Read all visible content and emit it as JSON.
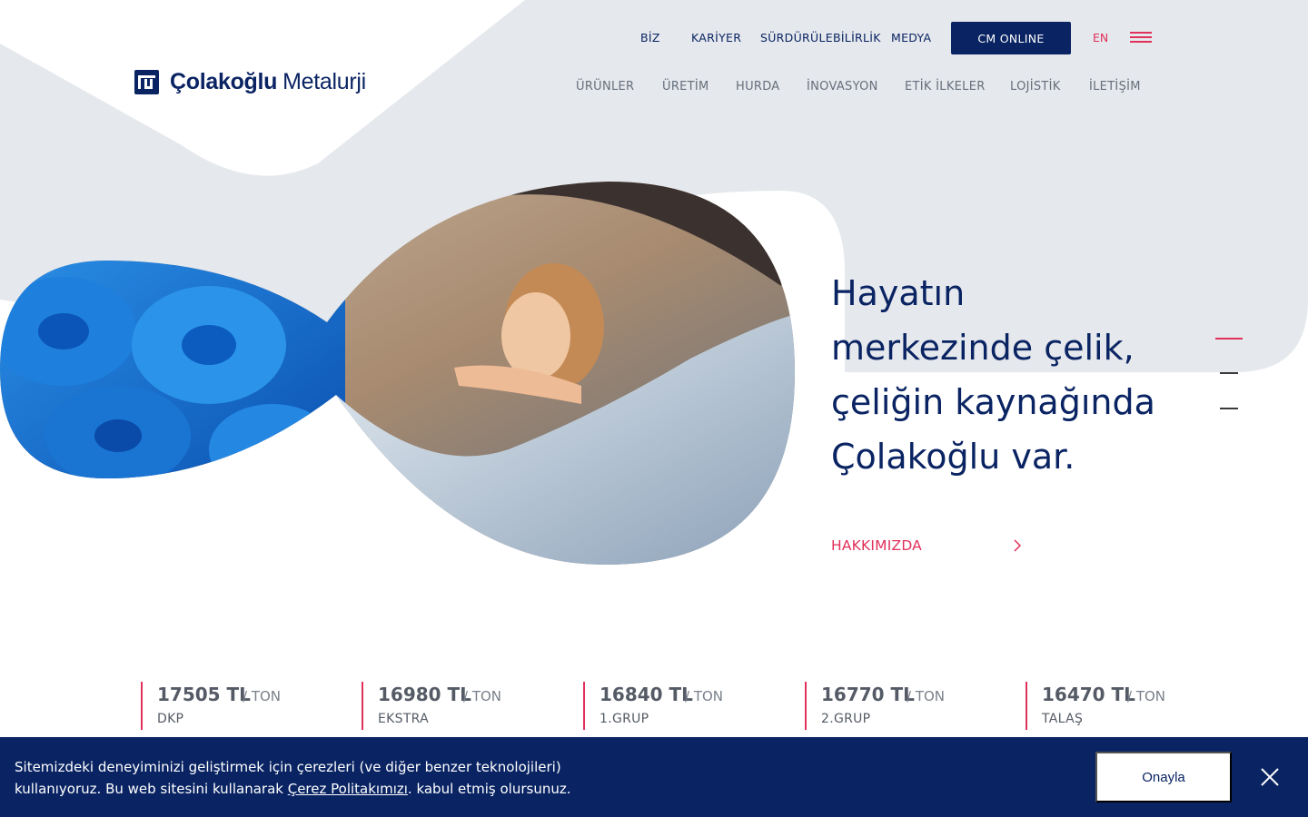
{
  "brand": {
    "name_bold": "Çolakoğlu",
    "name_light": "Metalurji",
    "primary_color": "#0a2463",
    "accent_color": "#e0315b",
    "background_shape_color": "#e5e8ec"
  },
  "top_nav": {
    "items": [
      "BİZ",
      "KARİYER",
      "SÜRDÜRÜLEBİLİRLİK",
      "MEDYA"
    ],
    "cm_online": "CM ONLINE",
    "language": "EN",
    "menu_icon": "hamburger-icon"
  },
  "main_nav": {
    "items": [
      "ÜRÜNLER",
      "ÜRETİM",
      "HURDA",
      "İNOVASYON",
      "ETİK İLKELER",
      "LOJİSTİK",
      "İLETİŞİM"
    ]
  },
  "hero": {
    "title_lines": [
      "Hayatın",
      "merkezinde çelik,",
      "çeliğin kaynağında",
      "Çolakoğlu var."
    ],
    "cta": "HAKKIMIZDA",
    "cta_icon": "chevron-right-icon",
    "slides_total": 3,
    "active_slide": 1
  },
  "prices": [
    {
      "value": "17505 TL",
      "unit": "/ TON",
      "label": "DKP"
    },
    {
      "value": "16980 TL",
      "unit": "/ TON",
      "label": "EKSTRA"
    },
    {
      "value": "16840 TL",
      "unit": "/ TON",
      "label": "1.GRUP"
    },
    {
      "value": "16770 TL",
      "unit": "/ TON",
      "label": "2.GRUP"
    },
    {
      "value": "16470 TL",
      "unit": "/ TON",
      "label": "TALAŞ"
    }
  ],
  "cookie": {
    "text_before": "Sitemizdeki deneyiminizi geliştirmek için çerezleri (ve diğer benzer teknolojileri) kullanıyoruz. Bu web sitesini kullanarak ",
    "link": "Çerez Politakımızı",
    "text_after": ". kabul etmiş olursunuz.",
    "accept": "Onayla",
    "close_icon": "close-icon"
  }
}
